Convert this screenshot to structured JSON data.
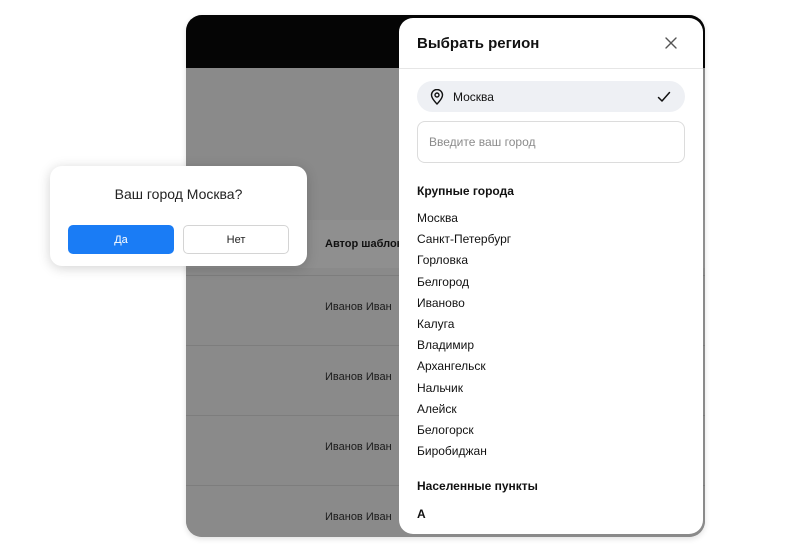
{
  "background_app": {
    "table": {
      "author_header": "Автор шаблона",
      "rows": [
        "Иванов Иван",
        "Иванов Иван",
        "Иванов Иван",
        "Иванов Иван"
      ]
    }
  },
  "region_panel": {
    "title": "Выбрать регион",
    "close_icon": "close-icon",
    "selected_city": "Москва",
    "input": {
      "value": "",
      "placeholder": "Введите ваш город"
    },
    "major_cities_title": "Крупные города",
    "major_cities": [
      "Москва",
      "Санкт-Петербург",
      "Горловка",
      "Белгород",
      "Иваново",
      "Калуга",
      "Владимир",
      "Архангельск",
      "Нальчик",
      "Алейск",
      "Белогорск",
      "Биробиджан"
    ],
    "settlements_title": "Населенные пункты",
    "settlements_first_letter": "А"
  },
  "confirm_popup": {
    "question": "Ваш город Москва?",
    "yes_label": "Да",
    "no_label": "Нет"
  },
  "colors": {
    "primary_button": "#1a7cf5",
    "overlay": "#8a8a8a",
    "header_dark": "#050505",
    "selected_city_bg": "#eef0f4"
  }
}
